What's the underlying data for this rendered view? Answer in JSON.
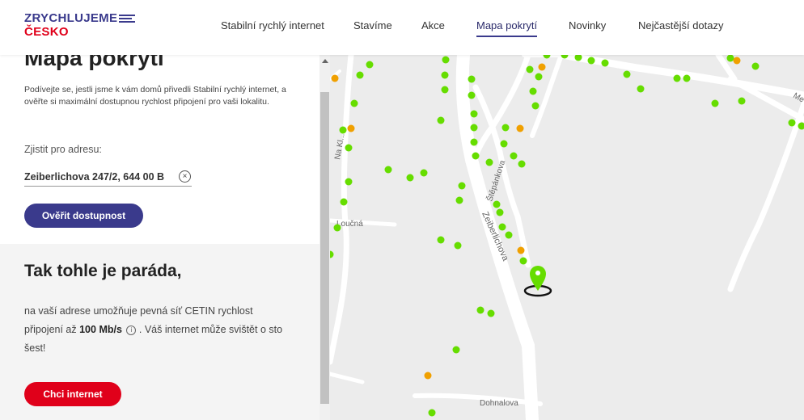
{
  "brand": {
    "line1": "ZRYCHLUJEME",
    "line2": "ČESKO"
  },
  "nav": {
    "items": [
      {
        "label": "Stabilní rychlý internet"
      },
      {
        "label": "Stavíme"
      },
      {
        "label": "Akce"
      },
      {
        "label": "Mapa pokrytí"
      },
      {
        "label": "Novinky"
      },
      {
        "label": "Nejčastější dotazy"
      }
    ],
    "active": "Mapa pokrytí"
  },
  "coverage": {
    "title": "Mapa pokrytí",
    "intro": "Podívejte se, jestli jsme k vám domů přivedli Stabilní rychlý internet, a ověřte si maximální dostupnou rychlost připojení pro vaši lokalitu.",
    "address_label": "Zjistit pro adresu:",
    "address_value": "Zeiberlichova 247/2, 644 00 B",
    "verify_button": "Ověřit dostupnost"
  },
  "result": {
    "title": "Tak tohle je paráda,",
    "text_before": "na vaší adrese umožňuje pevná síť CETIN rychlost připojení až",
    "speed": "100 Mb/s",
    "info_glyph": "i",
    "text_after": ". Váš internet může svištět o sto šest!",
    "cta_button": "Chci internet"
  },
  "map": {
    "streets": [
      "Na Kl...",
      "Loučná",
      "Štěpánkova",
      "Zeiberlichova",
      "Dohnalova",
      "Me..."
    ],
    "marker_colors": {
      "green": "#66dd00",
      "orange": "#f0a000",
      "pin": "#66dd00"
    }
  }
}
